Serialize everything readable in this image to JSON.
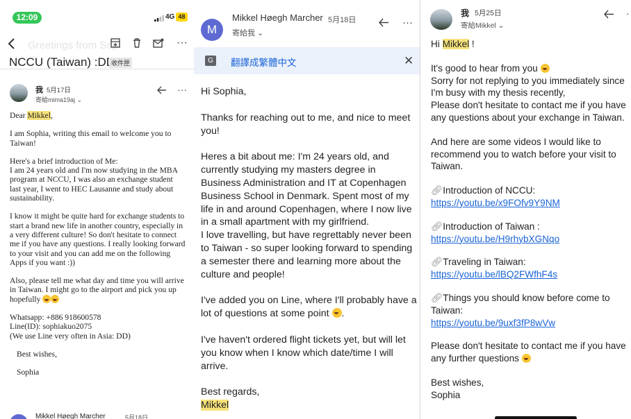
{
  "left": {
    "status_time": "12:09",
    "network": "4G",
    "battery": "48",
    "faded_subject": "Greetings from Sop",
    "subject": "NCCU (Taiwan) :DD",
    "inbox_badge": "收件匣",
    "sender": "我",
    "date": "5月17日",
    "to": "寄給mima19aj",
    "greeting_prefix": "Dear ",
    "greeting_name": "Mikkel",
    "greeting_suffix": ",",
    "paragraphs": [
      "I am Sophia, writing this email to welcome you to Taiwan!",
      "Here's a brief introduction of Me:\nI am 24 years old and I'm now studying in the MBA program at NCCU, I was also an exchange student last year, I went to HEC Lausanne and study about sustainability.",
      "I know it might be quite hard for exchange students to start a brand new life in another country, especially in a very different culture! So don't hesitate to connect me if you have any questions. I really looking forward to your visit and you can add me on the following Apps if you want :))",
      "Also, please tell me what day and time you will arrive in Taiwan. I might go to the airport and pick you up hopefully",
      "Whatsapp: +886 918600578\nLine(ID): sophiakuo2075\n(We use Line very often in Asia: DD)"
    ],
    "closing": "Best wishes,",
    "signature": "Sophia",
    "next_sender": "Mikkel Høegh Marcher",
    "next_date": "5月18日"
  },
  "middle": {
    "avatar_letter": "M",
    "sender": "Mikkel Høegh Marcher",
    "date": "5月18日",
    "to": "寄給我",
    "translate_label": "翻譯成繁體中文",
    "paragraphs": [
      "Hi Sophia,",
      "Thanks for reaching out to me, and nice to meet you!",
      "Heres a bit about me: I'm 24 years old, and currently studying my masters degree in Business Administration and IT at Copenhagen Business School in Denmark. Spent most of my life in and around Copenhagen, where I now live in a small apartment with my girlfriend.\nI love travelling, but have regrettably never been to Taiwan - so super looking forward to spending a semester there and learning more about the culture and people!",
      "I've added you on Line, where I'll probably have a lot of questions at some point",
      "I've haven't ordered flight tickets yet, but will let you know when I know which date/time I will arrive."
    ],
    "closing": "Best regards,",
    "signature": "Mikkel"
  },
  "right": {
    "sender": "我",
    "date": "5月25日",
    "to": "寄給Mikkel",
    "greeting_prefix": "Hi ",
    "greeting_name": "Mikkel",
    "greeting_suffix": " !",
    "intro_line1": "It's good to hear from you",
    "intro_rest": "Sorry for not replying to you immediately since I'm busy with my thesis recently,\nPlease don't hesitate to contact me if you have any questions about your exchange in Taiwan.",
    "videos_intro": "And here are some videos I would like to recommend you to watch before your visit to Taiwan.",
    "videos": [
      {
        "title": "Introduction of NCCU:",
        "url": "https://youtu.be/x9FOfv9Y9NM"
      },
      {
        "title": "Introduction of Taiwan :",
        "url": "https://youtu.be/H9rhybXGNqo"
      },
      {
        "title": "Traveling in Taiwan:",
        "url": "https://youtu.be/lBQ2FWfhF4s"
      },
      {
        "title": "Things you should know before come to Taiwan:",
        "url": "https://youtu.be/9uxf3fP8wVw"
      }
    ],
    "outro": "Please don't hesitate to contact me if you have any further questions",
    "closing": "Best wishes,",
    "signature": "Sophia"
  },
  "colors": {
    "accent": "#1a64d6",
    "highlight": "#f6e27a",
    "time_pill": "#34c759",
    "battery": "#ffd60a",
    "translate_bar": "#eaf1fb",
    "avatar_middle": "#5e6ad2"
  }
}
